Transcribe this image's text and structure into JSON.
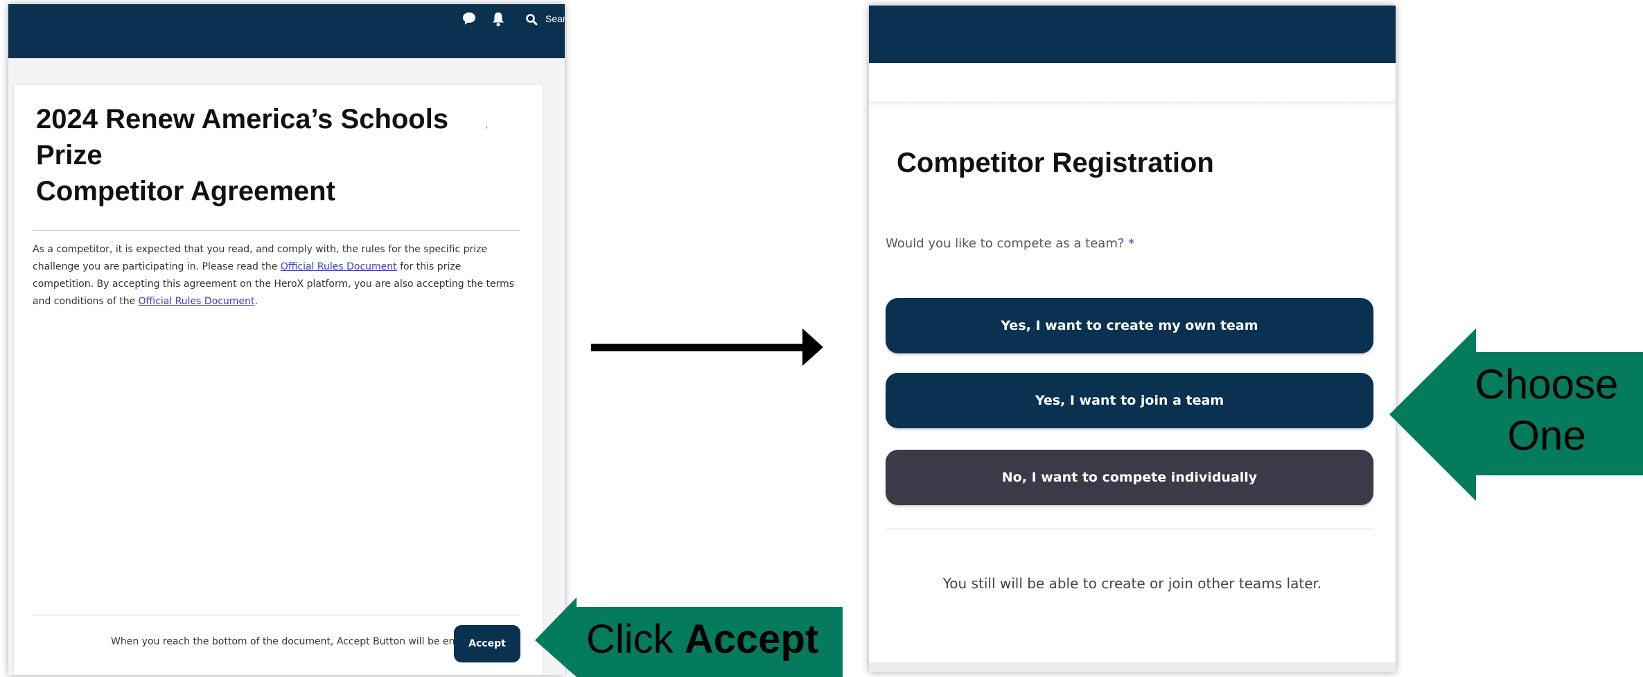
{
  "left_panel": {
    "search_label": "Searc",
    "title_line1": "2024 Renew America’s Schools Prize",
    "title_line2": "Competitor Agreement",
    "body": {
      "text1": "As a competitor, it is expected that you read, and comply with, the rules for the specific prize challenge you are participating in.  Please read the ",
      "link1": "Official Rules Document",
      "text2": " for this prize competition. By accepting this agreement on the HeroX platform, you are also accepting the terms and conditions of the ",
      "link2": "Official Rules Document",
      "text3": "."
    },
    "accept_note": "When you reach the bottom of the document, Accept Button will be enabled.",
    "accept_label": "Accept"
  },
  "right_panel": {
    "title": "Competitor Registration",
    "question": "Would you like to compete as a team?",
    "required_mark": "*",
    "choices": [
      "Yes, I want to create my own team",
      "Yes, I want to join a team",
      "No, I want to compete individually"
    ],
    "note": "You still will be able to create or join other teams later."
  },
  "callouts": {
    "click_prefix": "Click ",
    "click_bold": "Accept",
    "choose_line1": "Choose",
    "choose_line2": "One"
  },
  "colors": {
    "navy": "#0a3150",
    "dark_gray_button": "#3b3a48",
    "callout_green": "#047b5d",
    "link_blue": "#3a3ad6"
  },
  "icons": [
    "chat-icon",
    "bell-icon",
    "search-icon",
    "arrow-right-icon"
  ]
}
